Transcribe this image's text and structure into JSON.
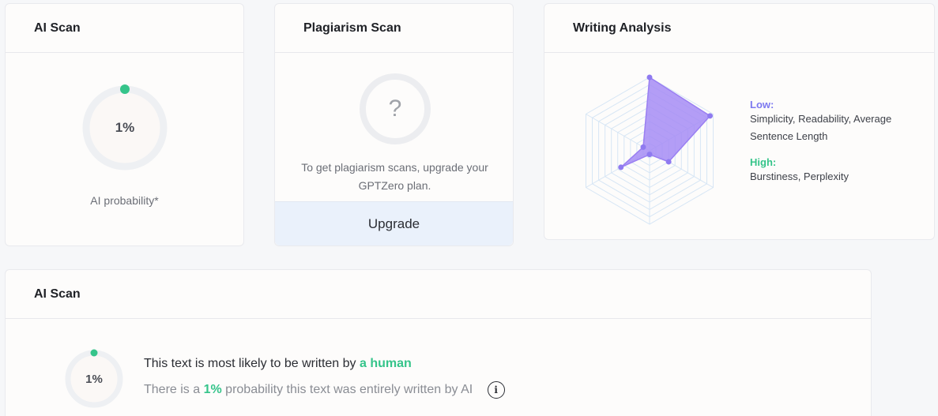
{
  "ai_scan_card": {
    "title": "AI Scan",
    "percent": "1%",
    "caption": "AI probability*"
  },
  "plagiarism_card": {
    "title": "Plagiarism Scan",
    "symbol": "?",
    "message": "To get plagiarism scans, upgrade your GPTZero plan.",
    "button_label": "Upgrade"
  },
  "writing_card": {
    "title": "Writing Analysis",
    "low_label": "Low:",
    "low_items": "Simplicity, Readability, Average Sentence Length",
    "high_label": "High:",
    "high_items": "Burstiness, Perplexity"
  },
  "ai_scan_detail": {
    "title": "AI Scan",
    "percent": "1%",
    "headline_prefix": "This text is most likely to be written by",
    "headline_highlight": "a human",
    "sub_prefix": "There is a",
    "sub_highlight": "1%",
    "sub_suffix": "probability this text was entirely written by AI",
    "info_symbol": "i"
  },
  "colors": {
    "accent_green": "#35c48a",
    "accent_purple": "#7c79f0",
    "upgrade_bg": "#eaf1fb"
  },
  "radar": {
    "levels": 10,
    "axes": 6,
    "values": [
      1.0,
      0.95,
      0.3,
      0.05,
      0.45,
      0.1
    ]
  }
}
